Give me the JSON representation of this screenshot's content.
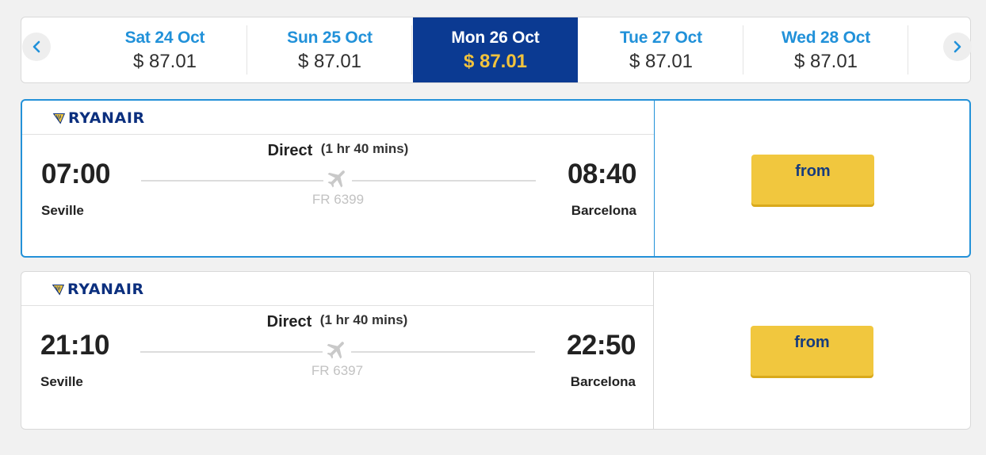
{
  "dates": [
    {
      "day": "Sat 24 Oct",
      "price": "$ 87.01",
      "selected": false
    },
    {
      "day": "Sun 25 Oct",
      "price": "$ 87.01",
      "selected": false
    },
    {
      "day": "Mon 26 Oct",
      "price": "$ 87.01",
      "selected": true
    },
    {
      "day": "Tue 27 Oct",
      "price": "$ 87.01",
      "selected": false
    },
    {
      "day": "Wed 28 Oct",
      "price": "$ 87.01",
      "selected": false
    }
  ],
  "nav": {
    "prev_icon": "chevron-left-icon",
    "next_icon": "chevron-right-icon"
  },
  "flights": [
    {
      "airline": "RYANAIR",
      "direct_label": "Direct",
      "duration": "(1 hr 40 mins)",
      "dep_time": "07:00",
      "dep_city": "Seville",
      "arr_time": "08:40",
      "arr_city": "Barcelona",
      "flight_no": "FR 6399",
      "button_label": "from",
      "active": true
    },
    {
      "airline": "RYANAIR",
      "direct_label": "Direct",
      "duration": "(1 hr 40 mins)",
      "dep_time": "21:10",
      "dep_city": "Seville",
      "arr_time": "22:50",
      "arr_city": "Barcelona",
      "flight_no": "FR 6397",
      "button_label": "from",
      "active": false
    }
  ],
  "colors": {
    "accent_blue": "#2191d9",
    "selected_bg": "#0b3a92",
    "selected_price": "#f2c33d",
    "button_yellow": "#f1c73e",
    "brand_navy": "#0b2f7e"
  }
}
